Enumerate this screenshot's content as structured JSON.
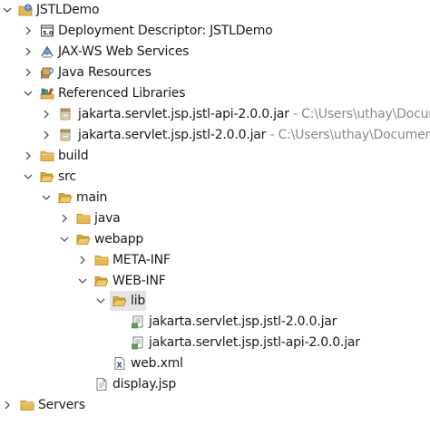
{
  "tree": {
    "project": {
      "label": "JSTLDemo"
    },
    "deployment_descriptor": {
      "label": "Deployment Descriptor: JSTLDemo"
    },
    "jaxws": {
      "label": "JAX-WS Web Services"
    },
    "java_resources": {
      "label": "Java Resources"
    },
    "referenced_libraries": {
      "label": "Referenced Libraries"
    },
    "ref_jars": [
      {
        "label": "jakarta.servlet.jsp.jstl-api-2.0.0.jar",
        "location": " - C:\\Users\\uthay\\Docume"
      },
      {
        "label": "jakarta.servlet.jsp.jstl-2.0.0.jar",
        "location": " - C:\\Users\\uthay\\Documents"
      }
    ],
    "build": {
      "label": "build"
    },
    "src": {
      "label": "src"
    },
    "main": {
      "label": "main"
    },
    "java": {
      "label": "java"
    },
    "webapp": {
      "label": "webapp"
    },
    "meta_inf": {
      "label": "META-INF"
    },
    "web_inf": {
      "label": "WEB-INF"
    },
    "lib": {
      "label": "lib"
    },
    "lib_jars": [
      {
        "label": "jakarta.servlet.jsp.jstl-2.0.0.jar"
      },
      {
        "label": "jakarta.servlet.jsp.jstl-api-2.0.0.jar"
      }
    ],
    "web_xml": {
      "label": "web.xml"
    },
    "display_jsp": {
      "label": "display.jsp"
    },
    "servers": {
      "label": "Servers"
    }
  },
  "icons": {
    "project": "web-project-icon",
    "deployment_descriptor": "deployment-descriptor-icon",
    "jaxws": "web-services-icon",
    "java_resources": "java-resources-icon",
    "referenced_libraries": "library-icon",
    "jar": "jar-file-icon",
    "folder": "folder-icon",
    "xml": "xml-file-icon",
    "jsp": "jsp-file-icon"
  },
  "colors": {
    "folder": "#e8b84a",
    "selection": "#e4e4e4",
    "location_text": "#8a8a8a",
    "arrow": "#555555"
  }
}
